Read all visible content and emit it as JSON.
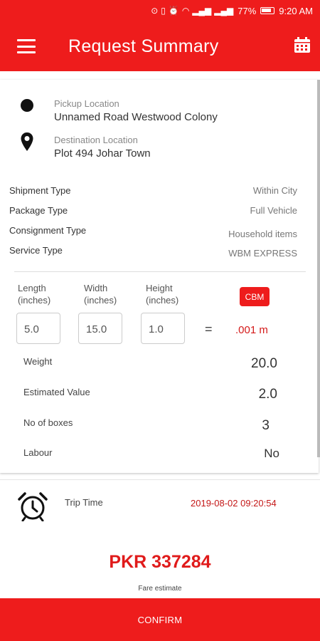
{
  "status_bar": {
    "battery": "77%",
    "time": "9:20 AM"
  },
  "header": {
    "title": "Request Summary"
  },
  "pickup": {
    "label": "Pickup Location",
    "value": "Unnamed Road Westwood Colony"
  },
  "destination": {
    "label": "Destination Location",
    "value": "Plot 494 Johar Town"
  },
  "shipment": [
    {
      "label": "Shipment Type",
      "value": "Within City"
    },
    {
      "label": "Package Type",
      "value": "Full Vehicle"
    },
    {
      "label": "Consignment Type",
      "value": "Household items"
    },
    {
      "label": "Service Type",
      "value": "WBM EXPRESS"
    }
  ],
  "dimensions": {
    "length_label_1": "Length",
    "length_label_2": "(inches)",
    "length_value": "5.0",
    "width_label_1": "Width",
    "width_label_2": "(inches)",
    "width_value": "15.0",
    "height_label_1": "Height",
    "height_label_2": "(inches)",
    "height_value": "1.0",
    "equals": "=",
    "cbm_label": "CBM",
    "cbm_result": ".001 m"
  },
  "details": [
    {
      "label": "Weight",
      "value": "20.0"
    },
    {
      "label": "Estimated Value",
      "value": "2.0"
    },
    {
      "label": "No of boxes",
      "value": "3"
    },
    {
      "label": "Labour",
      "value": "No"
    }
  ],
  "trip": {
    "label": "Trip Time",
    "value": "2019-08-02 09:20:54"
  },
  "fare": {
    "amount": "PKR 337284",
    "label": "Fare estimate"
  },
  "confirm_label": "CONFIRM",
  "colors": {
    "primary": "#ee1c1c",
    "accent_text": "#d41a1a"
  }
}
